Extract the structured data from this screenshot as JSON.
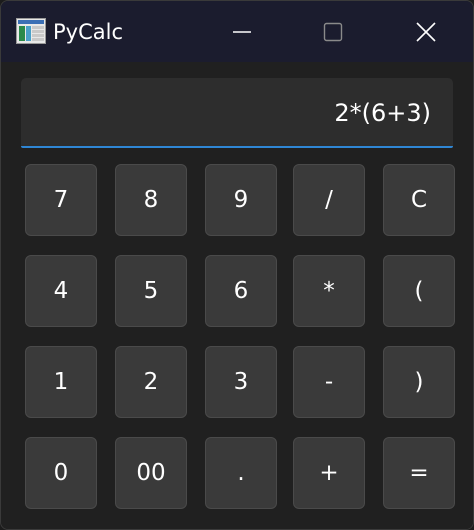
{
  "window": {
    "title": "PyCalc",
    "icon": "calculator-app-icon"
  },
  "title_controls": {
    "minimize_icon": "minimize-icon",
    "maximize_icon": "maximize-icon",
    "close_icon": "close-icon"
  },
  "display": {
    "value": "2*(6+3)"
  },
  "keys": {
    "r0": [
      "7",
      "8",
      "9",
      "/",
      "C"
    ],
    "r1": [
      "4",
      "5",
      "6",
      "*",
      "("
    ],
    "r2": [
      "1",
      "2",
      "3",
      "-",
      ")"
    ],
    "r3": [
      "0",
      "00",
      ".",
      "+",
      "="
    ]
  },
  "colors": {
    "titlebar": "#1b1c2e",
    "background": "#202020",
    "display_bg": "#2d2d2d",
    "accent": "#2f86d4",
    "key_bg": "#3a3a3a",
    "key_border": "#4a4a4a",
    "text": "#ffffff"
  }
}
